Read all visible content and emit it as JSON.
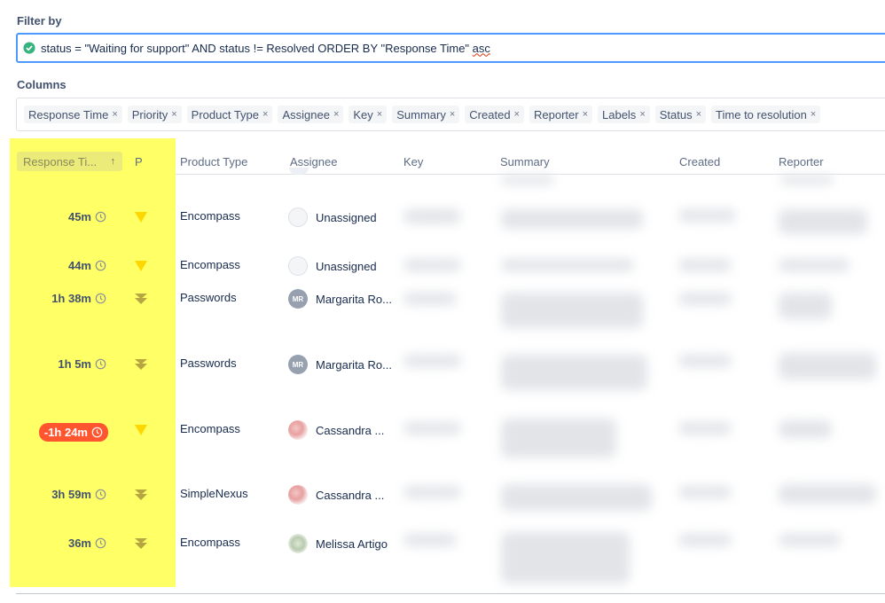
{
  "filter": {
    "label": "Filter by",
    "query_main": "status = \"Waiting for support\" AND status != Resolved ORDER BY \"Response Time\" ",
    "query_tail": "asc"
  },
  "columns_selector": {
    "label": "Columns",
    "chips": [
      "Response Time",
      "Priority",
      "Product Type",
      "Assignee",
      "Key",
      "Summary",
      "Created",
      "Reporter",
      "Labels",
      "Status",
      "Time to resolution"
    ],
    "remove_glyph": "×"
  },
  "table": {
    "headers": {
      "response_time": "Response Ti...",
      "sort_arrow": "↑",
      "priority": "P",
      "product_type": "Product Type",
      "assignee": "Assignee",
      "key": "Key",
      "summary": "Summary",
      "created": "Created",
      "reporter": "Reporter"
    },
    "rows": [
      {
        "response_time": "45m",
        "breached": false,
        "priority": "low",
        "product_type": "Encompass",
        "assignee": "Unassigned",
        "avatar": "unassigned"
      },
      {
        "response_time": "44m",
        "breached": false,
        "priority": "low",
        "product_type": "Encompass",
        "assignee": "Unassigned",
        "avatar": "unassigned"
      },
      {
        "response_time": "1h 38m",
        "breached": false,
        "priority": "lowest",
        "product_type": "Passwords",
        "assignee": "Margarita Ro...",
        "avatar": "initials",
        "initials": "MR"
      },
      {
        "response_time": "1h 5m",
        "breached": false,
        "priority": "lowest",
        "product_type": "Passwords",
        "assignee": "Margarita Ro...",
        "avatar": "initials",
        "initials": "MR"
      },
      {
        "response_time": "-1h 24m",
        "breached": true,
        "priority": "low",
        "product_type": "Encompass",
        "assignee": "Cassandra ...",
        "avatar": "photo"
      },
      {
        "response_time": "3h 59m",
        "breached": false,
        "priority": "lowest",
        "product_type": "SimpleNexus",
        "assignee": "Cassandra ...",
        "avatar": "photo"
      },
      {
        "response_time": "36m",
        "breached": false,
        "priority": "lowest",
        "product_type": "Encompass",
        "assignee": "Melissa Artigo",
        "avatar": "photo"
      }
    ]
  },
  "colors": {
    "highlight": "#ffff66",
    "priority_low": "#ffd700",
    "priority_lowest": "#b5a642",
    "breach": "#ff5630",
    "focus_border": "#4c9aff",
    "valid_check": "#36b37e"
  },
  "icons": [
    "check-circle-icon",
    "remove-icon",
    "sort-ascending-icon",
    "clock-icon",
    "priority-low-icon",
    "priority-lowest-icon",
    "avatar-icon"
  ]
}
